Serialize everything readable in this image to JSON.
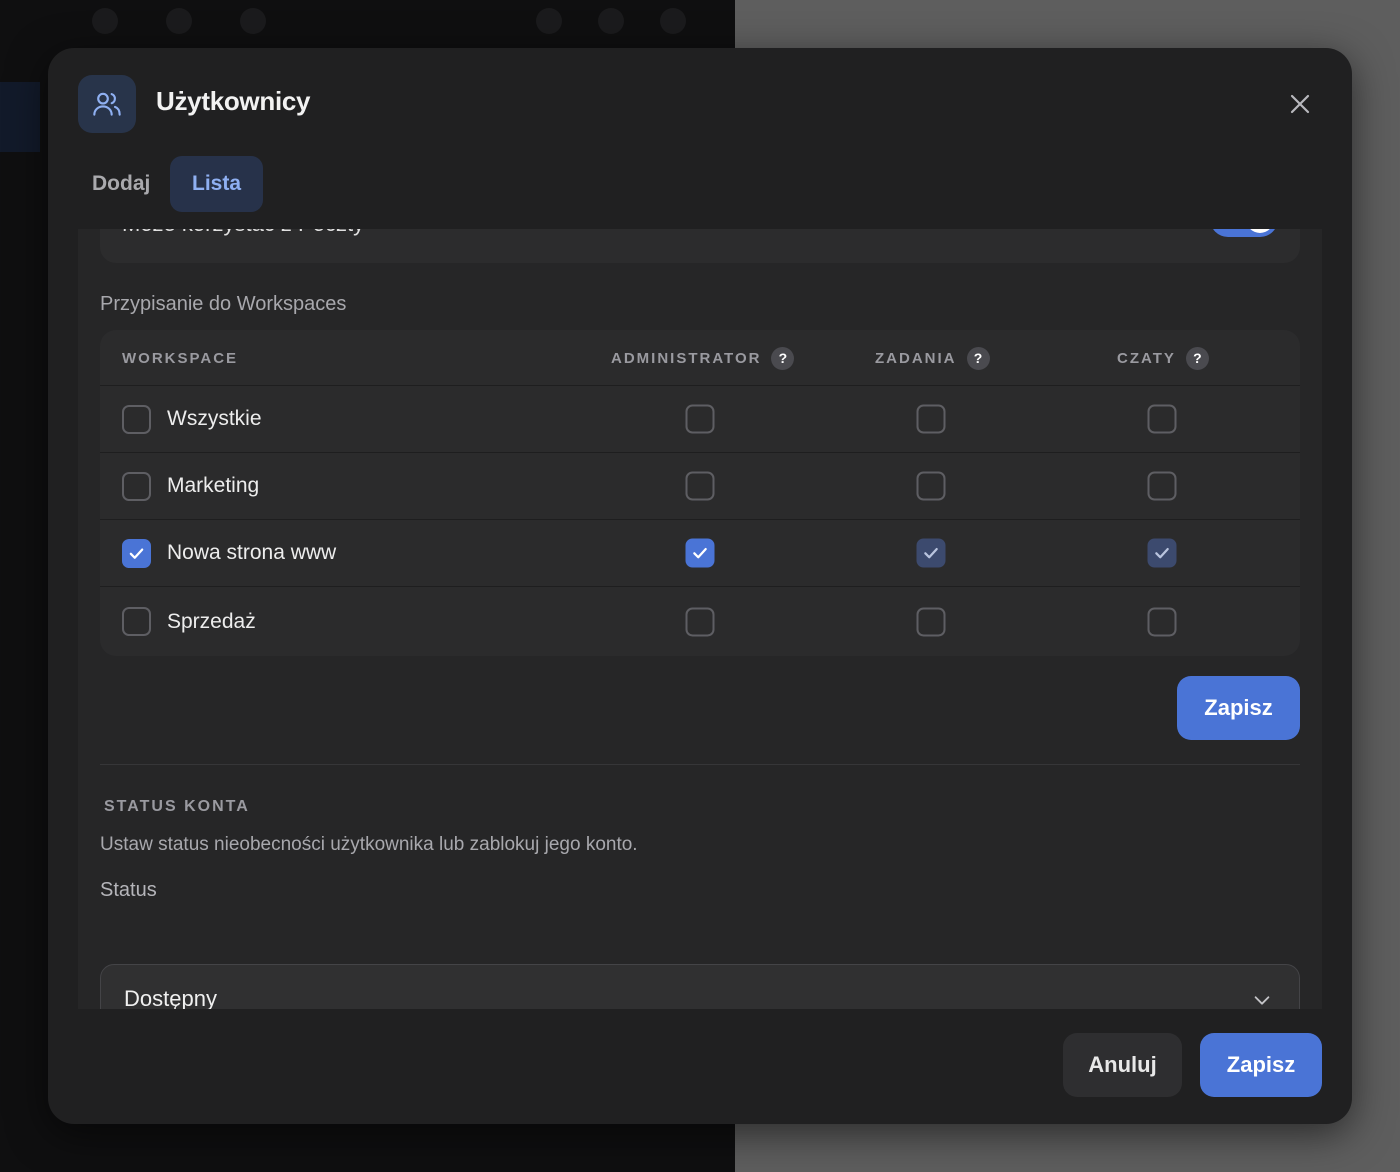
{
  "modal": {
    "title": "Użytkownicy",
    "icon": "users-icon",
    "close_icon": "close-icon"
  },
  "tabs": [
    {
      "label": "Dodaj",
      "active": false
    },
    {
      "label": "Lista",
      "active": true
    }
  ],
  "top_setting": {
    "label": "Może korzystać z Poczty",
    "enabled": true
  },
  "workspaces": {
    "section_label": "Przypisanie do Workspaces",
    "columns": {
      "workspace": "WORKSPACE",
      "administrator": "ADMINISTRATOR",
      "zadania": "ZADANIA",
      "czaty": "CZATY",
      "help": "?"
    },
    "rows": [
      {
        "name": "Wszystkie",
        "selected": false,
        "administrator": false,
        "zadania": false,
        "czaty": false
      },
      {
        "name": "Marketing",
        "selected": false,
        "administrator": false,
        "zadania": false,
        "czaty": false
      },
      {
        "name": "Nowa strona www",
        "selected": true,
        "administrator": true,
        "zadania": true,
        "czaty": true
      },
      {
        "name": "Sprzedaż",
        "selected": false,
        "administrator": false,
        "zadania": false,
        "czaty": false
      }
    ],
    "save_label": "Zapisz"
  },
  "account_status": {
    "title": "STATUS KONTA",
    "description": "Ustaw status nieobecności użytkownika lub zablokuj jego konto.",
    "field_label": "Status",
    "selected_value": "Dostępny"
  },
  "footer": {
    "cancel_label": "Anuluj",
    "save_label": "Zapisz"
  },
  "colors": {
    "accent": "#4a74d6",
    "accent_dim": "#3c4a6e",
    "modal_bg": "#202021",
    "tab_active_bg": "#27324a",
    "tab_active_text": "#8fb0f2"
  }
}
